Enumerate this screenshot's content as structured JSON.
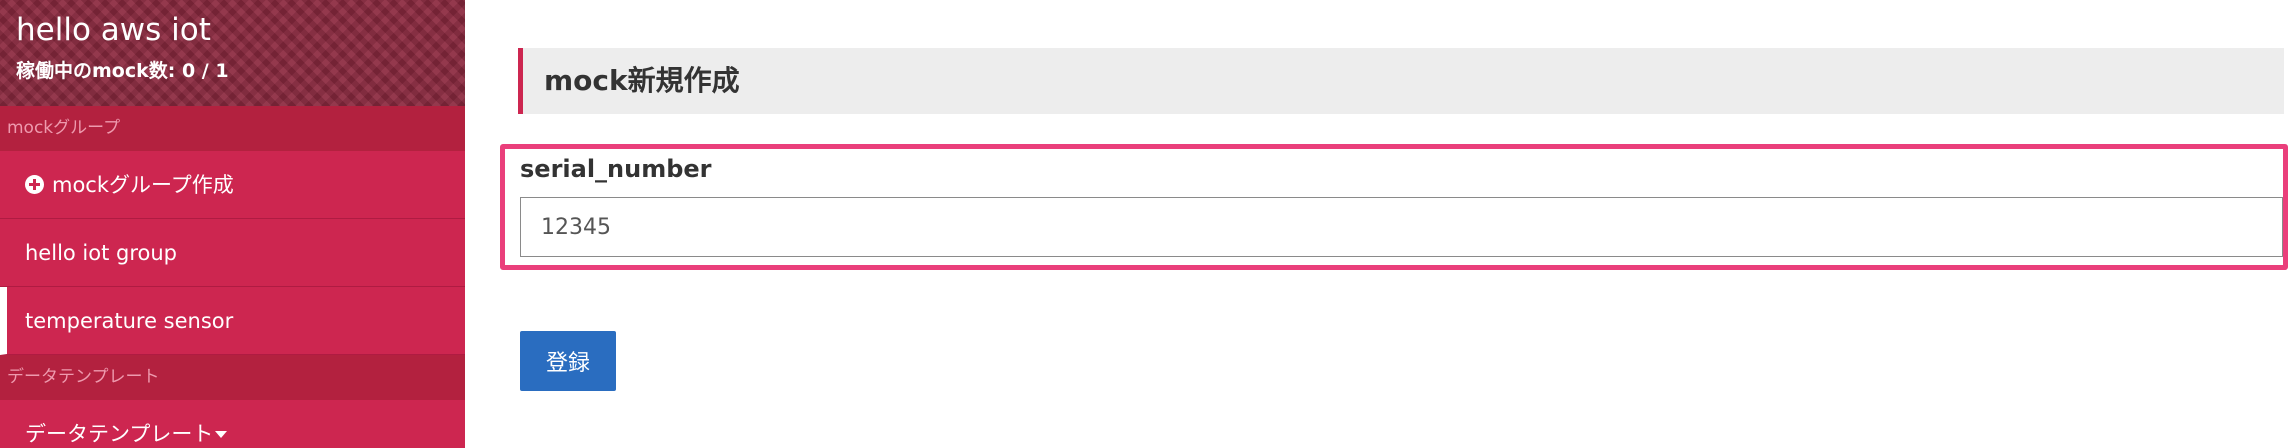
{
  "sidebar": {
    "app_title": "hello aws iot",
    "mock_count": "稼働中のmock数: 0 / 1",
    "sections": [
      {
        "label": "mockグループ",
        "items": [
          {
            "label": "mockグループ作成",
            "icon": "plus-circle-icon"
          },
          {
            "label": "hello iot group"
          },
          {
            "label": "temperature sensor",
            "active": true
          }
        ]
      },
      {
        "label": "データテンプレート",
        "items": [
          {
            "label": "データテンプレート",
            "icon": "caret-down-icon"
          }
        ]
      }
    ]
  },
  "main": {
    "page_title": "mock新規作成",
    "form": {
      "field_label": "serial_number",
      "field_value": "12345",
      "submit_label": "登録"
    }
  },
  "colors": {
    "sidebar_bg": "#cd2650",
    "sidebar_section_bg": "#b3213f",
    "highlight_border": "#ea3f7b",
    "button_bg": "#2a6dc0"
  }
}
